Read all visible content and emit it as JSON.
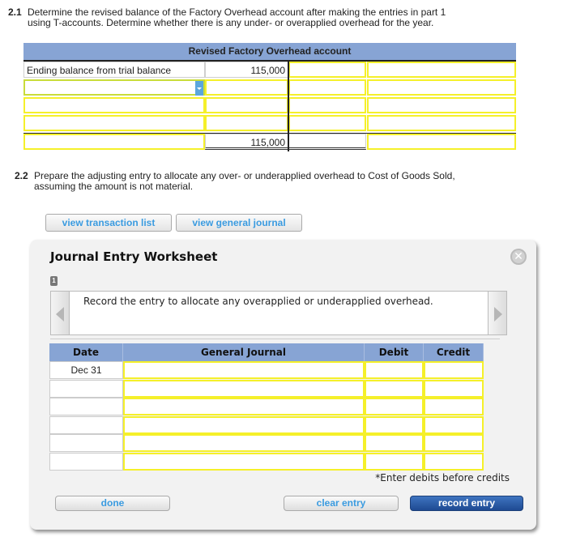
{
  "question_2_1": {
    "number": "2.1",
    "line1": "Determine the revised balance of the Factory Overhead account after making the entries in part 1",
    "line2": "using T-accounts. Determine whether there is any under- or overapplied overhead for the year."
  },
  "t_account": {
    "title": "Revised Factory Overhead account",
    "rows": [
      {
        "label": "Ending balance from trial balance",
        "debit": "115,000",
        "credit": "",
        "balance": ""
      },
      {
        "label": "",
        "debit": "",
        "credit": "",
        "balance": "",
        "has_dropdown": true
      },
      {
        "label": "",
        "debit": "",
        "credit": "",
        "balance": ""
      },
      {
        "label": "",
        "debit": "",
        "credit": "",
        "balance": ""
      }
    ],
    "total_row": {
      "label": "",
      "debit": "115,000",
      "credit": "",
      "balance": ""
    }
  },
  "question_2_2": {
    "number": "2.2",
    "line1": "Prepare the adjusting entry to allocate any over- or underapplied overhead to Cost of Goods Sold,",
    "line2": "assuming the amount is not material."
  },
  "toolbar": {
    "view_transaction_list": "view transaction list",
    "view_general_journal": "view general journal"
  },
  "worksheet": {
    "title": "Journal Entry Worksheet",
    "close_icon": "close-icon",
    "step": "1",
    "instruction": "Record the entry to allocate any overapplied or underapplied overhead.",
    "columns": [
      "Date",
      "General Journal",
      "Debit",
      "Credit"
    ],
    "rows": [
      {
        "date": "Dec 31",
        "account": "",
        "debit": "",
        "credit": ""
      },
      {
        "date": "",
        "account": "",
        "debit": "",
        "credit": ""
      },
      {
        "date": "",
        "account": "",
        "debit": "",
        "credit": ""
      },
      {
        "date": "",
        "account": "",
        "debit": "",
        "credit": ""
      },
      {
        "date": "",
        "account": "",
        "debit": "",
        "credit": ""
      },
      {
        "date": "",
        "account": "",
        "debit": "",
        "credit": ""
      }
    ],
    "note": "*Enter debits before credits",
    "buttons": {
      "done": "done",
      "clear_entry": "clear entry",
      "record_entry": "record entry"
    }
  },
  "colors": {
    "header_blue": "#87a4d4",
    "input_yellow": "#f5f02a",
    "link_blue": "#3a9be0",
    "primary_button": "#1e4a92"
  }
}
